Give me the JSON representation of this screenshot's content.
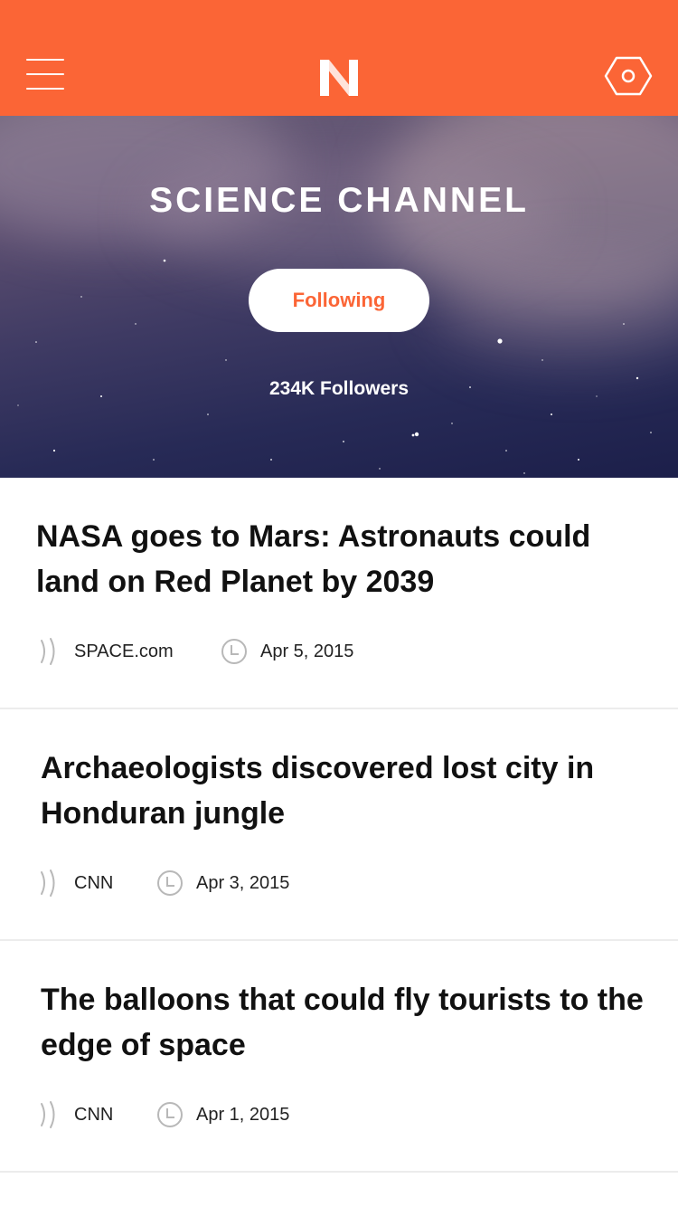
{
  "header": {
    "menu_icon": "hamburger-menu-icon",
    "logo_letter": "N",
    "settings_icon": "hexagon-settings-icon",
    "accent_color": "#fb6536"
  },
  "channel": {
    "title": "SCIENCE CHANNEL",
    "follow_label": "Following",
    "followers": "234K Followers"
  },
  "articles": [
    {
      "title": "NASA goes to Mars: Astronauts could land on Red Planet by 2039",
      "source": "SPACE.com",
      "date": "Apr 5, 2015"
    },
    {
      "title": "Archaeologists discovered lost city in Honduran jungle",
      "source": "CNN",
      "date": "Apr 3, 2015"
    },
    {
      "title": "The balloons that could fly tourists to the edge of space",
      "source": "CNN",
      "date": "Apr 1, 2015"
    }
  ]
}
